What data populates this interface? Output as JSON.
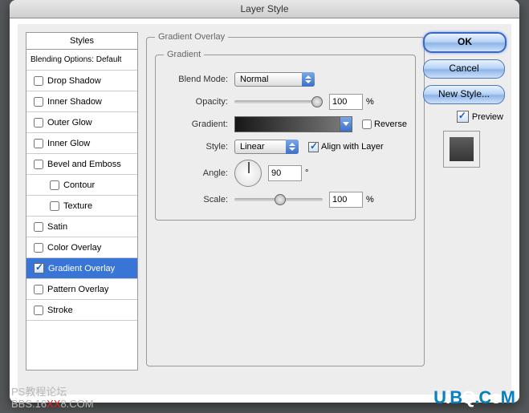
{
  "dialog_title": "Layer Style",
  "styles_panel": {
    "header": "Styles",
    "blending_options": "Blending Options: Default",
    "items": [
      {
        "label": "Drop Shadow",
        "checked": false
      },
      {
        "label": "Inner Shadow",
        "checked": false
      },
      {
        "label": "Outer Glow",
        "checked": false
      },
      {
        "label": "Inner Glow",
        "checked": false
      },
      {
        "label": "Bevel and Emboss",
        "checked": false
      },
      {
        "label": "Contour",
        "checked": false,
        "sub": true
      },
      {
        "label": "Texture",
        "checked": false,
        "sub": true
      },
      {
        "label": "Satin",
        "checked": false
      },
      {
        "label": "Color Overlay",
        "checked": false
      },
      {
        "label": "Gradient Overlay",
        "checked": true,
        "selected": true
      },
      {
        "label": "Pattern Overlay",
        "checked": false
      },
      {
        "label": "Stroke",
        "checked": false
      }
    ]
  },
  "section_title": "Gradient Overlay",
  "group_title": "Gradient",
  "labels": {
    "blend_mode": "Blend Mode:",
    "opacity": "Opacity:",
    "gradient": "Gradient:",
    "style": "Style:",
    "align": "Align with Layer",
    "reverse": "Reverse",
    "angle": "Angle:",
    "scale": "Scale:"
  },
  "values": {
    "blend_mode": "Normal",
    "opacity": "100",
    "style": "Linear",
    "reverse": false,
    "align": true,
    "angle": "90",
    "angle_unit": "°",
    "scale": "100",
    "percent": "%"
  },
  "buttons": {
    "ok": "OK",
    "cancel": "Cancel",
    "new_style": "New Style...",
    "preview": "Preview"
  },
  "watermark": {
    "line1": "PS教程论坛",
    "line2a": "BBS.16",
    "line2b": "XX",
    "line2c": "8.COM"
  },
  "logo": "UiBQ.CoM"
}
